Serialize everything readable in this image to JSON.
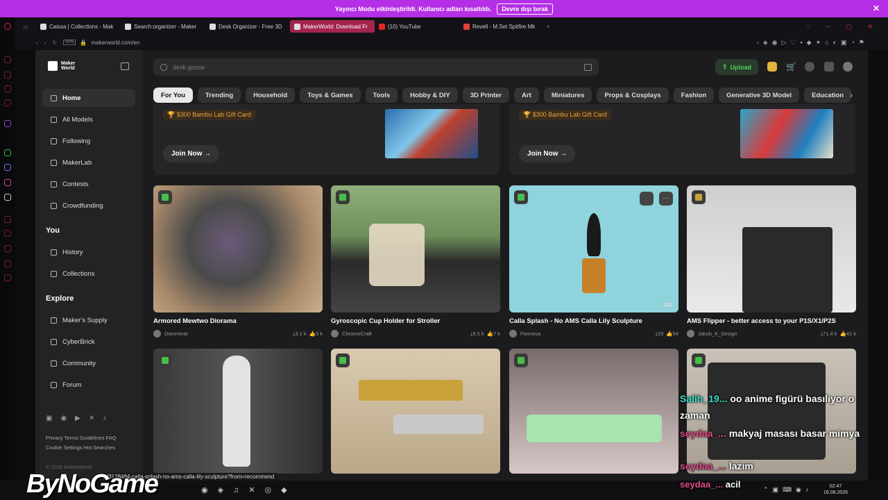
{
  "banner": {
    "text": "Yayıncı Modu etkinleştirildi. Kullanıcı adları kısaltıldı.",
    "button": "Devre dışı bırak"
  },
  "browser": {
    "tabs": [
      {
        "label": "Caissa | Collections - Mak",
        "active": false
      },
      {
        "label": "Search:organizer - Maker",
        "active": false
      },
      {
        "label": "Desk Organizer - Free 3D",
        "active": false
      },
      {
        "label": "MakerWorld: Download Fr",
        "active": true
      },
      {
        "label": "(10) YouTube",
        "active": false
      },
      {
        "label": "Revell - M.Set Spitfire Mk",
        "active": false
      }
    ],
    "url": "makerworld.com/en"
  },
  "sidebar": {
    "logo": [
      "Maker",
      "World"
    ],
    "items": [
      "Home",
      "All Models",
      "Following",
      "MakerLab",
      "Contests",
      "Crowdfunding"
    ],
    "you_title": "You",
    "you_items": [
      "History",
      "Collections"
    ],
    "explore_title": "Explore",
    "explore_items": [
      "Maker's Supply",
      "CyberBrick",
      "Community",
      "Forum"
    ],
    "footer_links_1": "Privacy  Terms  Guidelines  FAQ",
    "footer_links_2": "Cookie Settings  Hot Searches",
    "copyright": "© 2026 MakerWorld"
  },
  "search": {
    "placeholder": "desk goose"
  },
  "header": {
    "upload": "Upload"
  },
  "categories": [
    "For You",
    "Trending",
    "Household",
    "Toys & Games",
    "Tools",
    "Hobby & DIY",
    "3D Printer",
    "Art",
    "Miniatures",
    "Props & Cosplays",
    "Fashion",
    "Generative 3D Model",
    "Education"
  ],
  "promos": [
    {
      "gift": "$300 Bambu Lab Gift Card",
      "join": "Join Now →"
    },
    {
      "gift": "$300 Bambu Lab Gift Card",
      "join": "Join Now →"
    }
  ],
  "models": [
    {
      "title": "Armored Mewtwo Diorama",
      "author": "Dommivat",
      "downloads": "3.1 k",
      "likes": "3 k",
      "gif": ""
    },
    {
      "title": "Gyroscopic Cup Holder for Stroller",
      "author": "ChromeCraft",
      "downloads": "9.5 k",
      "likes": "7 k",
      "gif": ""
    },
    {
      "title": "Calla Splash - No AMS Calla Lily Sculpture",
      "author": "Fiornova",
      "downloads": "19",
      "likes": "54",
      "gif": "GIF"
    },
    {
      "title": "AMS Flipper - better access to your P1S/X1/P2S",
      "author": "Jakob_K_Design",
      "downloads": "71.4 k",
      "likes": "41 k",
      "gif": "GIF"
    }
  ],
  "chat": [
    {
      "user": "Salih_19...",
      "msg": "oo anime figürü basılıyor o zaman"
    },
    {
      "user": "seydaa_...",
      "msg": "makyaj masası basar mimya"
    },
    {
      "user": "seydaa_...",
      "msg": "lazım"
    },
    {
      "user": "seydaa_...",
      "msg": "acil"
    }
  ],
  "overlay": {
    "watermark": "ByNoGame",
    "status_url": "/3128484-calla-splash-no-ams-calla-lily-sculpture?from=recommend"
  },
  "clock": {
    "time": "02:47",
    "date": "16.08.2026"
  }
}
